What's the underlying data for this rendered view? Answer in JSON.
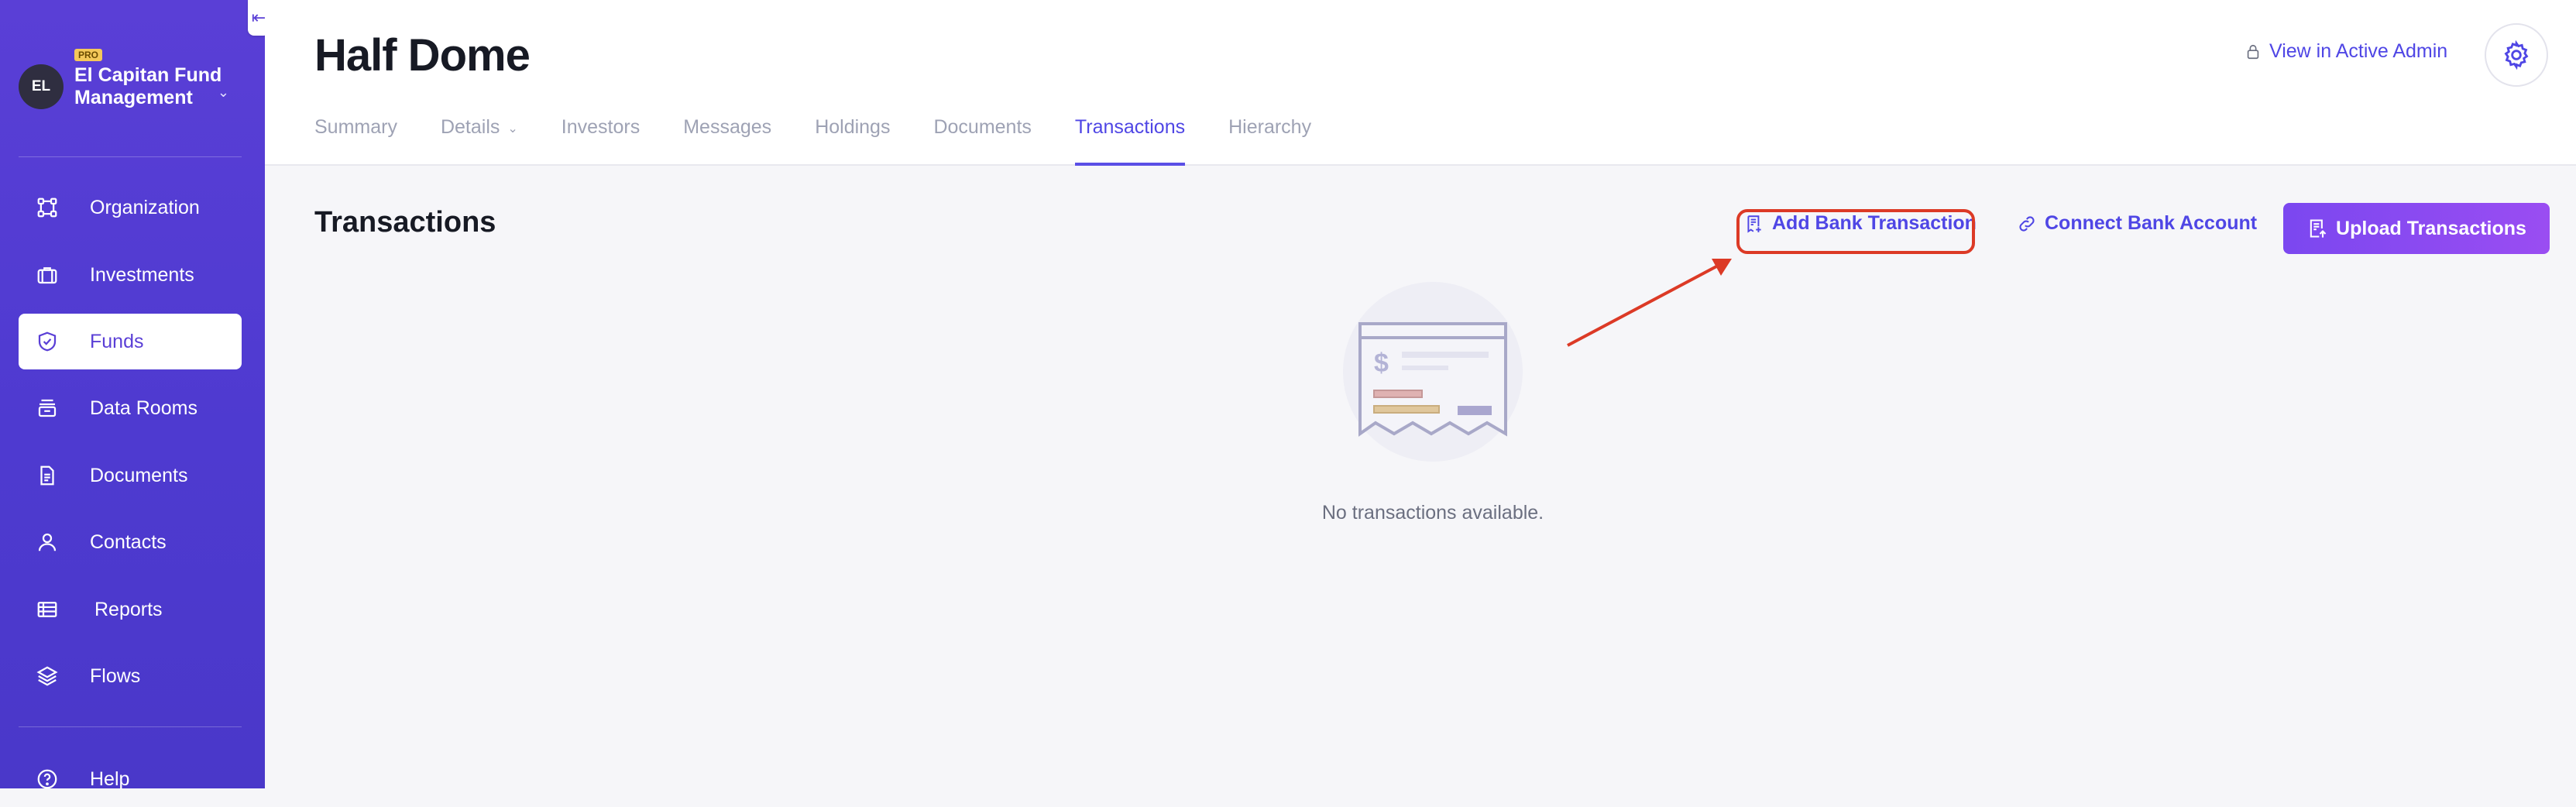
{
  "sidebar": {
    "org": {
      "initials": "EL",
      "badge": "PRO",
      "name": "El Capitan Fund Management"
    },
    "items": [
      {
        "label": "Organization",
        "icon": "organization-icon"
      },
      {
        "label": "Investments",
        "icon": "briefcase-icon"
      },
      {
        "label": "Funds",
        "icon": "shield-check-icon",
        "active": true
      },
      {
        "label": "Data Rooms",
        "icon": "data-rooms-icon"
      },
      {
        "label": "Documents",
        "icon": "document-icon"
      },
      {
        "label": "Contacts",
        "icon": "person-icon"
      },
      {
        "label": "Reports",
        "icon": "table-icon"
      },
      {
        "label": "Flows",
        "icon": "layers-icon"
      },
      {
        "label": "Help",
        "icon": "help-circle-icon"
      }
    ]
  },
  "header": {
    "title": "Half Dome",
    "admin_link": "View in Active Admin",
    "tabs": [
      {
        "label": "Summary"
      },
      {
        "label": "Details"
      },
      {
        "label": "Investors"
      },
      {
        "label": "Messages"
      },
      {
        "label": "Holdings"
      },
      {
        "label": "Documents"
      },
      {
        "label": "Transactions",
        "active": true
      },
      {
        "label": "Hierarchy"
      }
    ]
  },
  "main": {
    "section_title": "Transactions",
    "actions": {
      "add_bank_transaction": "Add Bank Transaction",
      "connect_bank_account": "Connect Bank Account",
      "upload_transactions": "Upload Transactions"
    },
    "empty_state": "No transactions available."
  },
  "colors": {
    "accent": "#4f46e5",
    "sidebar": "#5a3fd6",
    "upload_button": "#8b4af1",
    "annotation": "#dc3a26"
  }
}
